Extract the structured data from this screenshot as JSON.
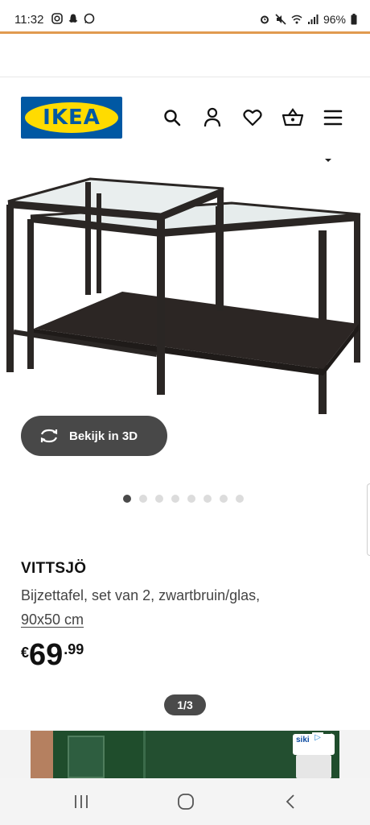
{
  "status_bar": {
    "time": "11:32",
    "battery": "96%",
    "left_icons": [
      "instagram-icon",
      "snapchat-icon",
      "whatsapp-icon"
    ],
    "right_icons": [
      "alarm-icon",
      "mute-icon",
      "wifi-icon",
      "signal-icon",
      "battery-icon"
    ]
  },
  "header": {
    "logo_text": "IKEA",
    "icons": [
      "search-icon",
      "account-icon",
      "favorites-icon",
      "cart-icon",
      "menu-icon"
    ]
  },
  "product": {
    "view_3d_label": "Bekijk in 3D",
    "name": "VITTSJÖ",
    "description": "Bijzettafel, set van 2, zwartbruin/glas,",
    "size": "90x50 cm",
    "price": {
      "currency": "€",
      "whole": "69",
      "decimal": ".99"
    },
    "image_carousel": {
      "total_dots": 8,
      "active_index": 0
    }
  },
  "page_counter": "1/3",
  "ad": {
    "badge_text": "siki"
  },
  "nav": {
    "buttons": [
      "recent-apps-button",
      "home-button",
      "back-button"
    ]
  },
  "colors": {
    "accent_line": "#e09a50",
    "ikea_blue": "#0058a3",
    "ikea_yellow": "#ffdb00",
    "button_dark": "#484848"
  }
}
